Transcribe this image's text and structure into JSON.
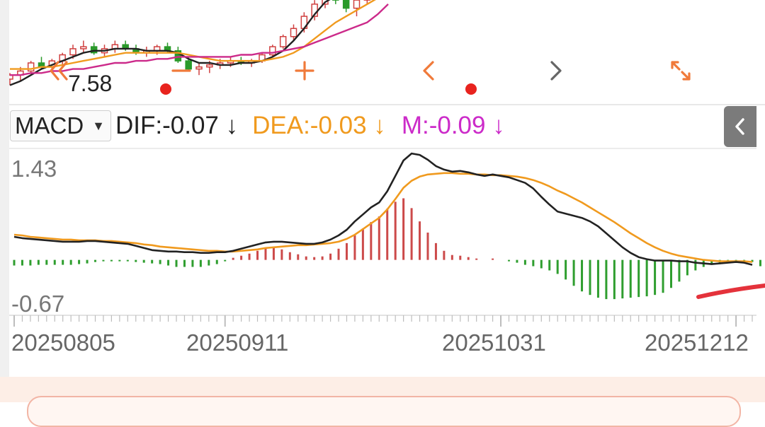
{
  "price_panel": {
    "last_price_label": "7.58",
    "controls": [
      {
        "name": "scroll-left-fast-button",
        "icon": "double-chevron-left-icon",
        "bg": "#fde6dc",
        "color": "#f07a3a"
      },
      {
        "name": "zoom-out-button",
        "icon": "minus-icon",
        "bg": "#fde6dc",
        "color": "#f07a3a"
      },
      {
        "name": "zoom-in-button",
        "icon": "plus-icon",
        "bg": "#fde6dc",
        "color": "#f07a3a"
      },
      {
        "name": "scroll-left-button",
        "icon": "chevron-left-icon",
        "bg": "#fde6dc",
        "color": "#f07a3a"
      },
      {
        "name": "scroll-right-button",
        "icon": "chevron-right-icon",
        "bg": "#eeeeee",
        "color": "#666666"
      },
      {
        "name": "fullscreen-button",
        "icon": "expand-icon",
        "bg": "#fde6dc",
        "color": "#f07a3a"
      }
    ]
  },
  "macd_header": {
    "indicator": "MACD",
    "dif": "DIF:-0.07 ↓",
    "dea": "DEA:-0.03 ↓",
    "m": "M:-0.09 ↓"
  },
  "chart_data": {
    "type": "line",
    "title": "MACD",
    "ylim": [
      -0.67,
      1.43
    ],
    "yticks": [
      "1.43",
      "-0.67"
    ],
    "x_tick_labels": [
      "20250805",
      "20250911",
      "20251031",
      "20251212"
    ],
    "x_tick_index": [
      0,
      26,
      60,
      89
    ],
    "series": [
      {
        "name": "DIF",
        "color": "#222222",
        "values": [
          0.33,
          0.31,
          0.3,
          0.29,
          0.28,
          0.27,
          0.26,
          0.26,
          0.26,
          0.27,
          0.27,
          0.26,
          0.25,
          0.24,
          0.23,
          0.2,
          0.17,
          0.14,
          0.13,
          0.12,
          0.12,
          0.11,
          0.11,
          0.1,
          0.1,
          0.11,
          0.11,
          0.13,
          0.16,
          0.19,
          0.22,
          0.25,
          0.26,
          0.26,
          0.25,
          0.24,
          0.23,
          0.23,
          0.25,
          0.29,
          0.35,
          0.43,
          0.55,
          0.65,
          0.75,
          0.82,
          0.98,
          1.2,
          1.42,
          1.52,
          1.5,
          1.43,
          1.34,
          1.29,
          1.26,
          1.27,
          1.25,
          1.22,
          1.2,
          1.22,
          1.2,
          1.18,
          1.14,
          1.1,
          1.02,
          0.9,
          0.79,
          0.69,
          0.66,
          0.63,
          0.6,
          0.55,
          0.48,
          0.38,
          0.28,
          0.18,
          0.1,
          0.04,
          0.01,
          -0.01,
          -0.01,
          -0.01,
          -0.02,
          -0.02,
          -0.04,
          -0.05,
          -0.06,
          -0.05,
          -0.04,
          -0.03,
          -0.04,
          -0.07
        ]
      },
      {
        "name": "DEA",
        "color": "#f09a1e",
        "values": [
          0.36,
          0.35,
          0.33,
          0.32,
          0.31,
          0.3,
          0.29,
          0.29,
          0.28,
          0.28,
          0.28,
          0.27,
          0.27,
          0.26,
          0.25,
          0.24,
          0.22,
          0.21,
          0.19,
          0.18,
          0.17,
          0.16,
          0.15,
          0.14,
          0.13,
          0.13,
          0.12,
          0.12,
          0.13,
          0.14,
          0.15,
          0.17,
          0.18,
          0.19,
          0.2,
          0.21,
          0.21,
          0.22,
          0.23,
          0.24,
          0.26,
          0.3,
          0.36,
          0.44,
          0.52,
          0.6,
          0.72,
          0.87,
          1.03,
          1.13,
          1.19,
          1.22,
          1.23,
          1.24,
          1.24,
          1.23,
          1.23,
          1.22,
          1.22,
          1.21,
          1.21,
          1.2,
          1.19,
          1.17,
          1.14,
          1.1,
          1.05,
          0.99,
          0.94,
          0.88,
          0.82,
          0.75,
          0.68,
          0.61,
          0.54,
          0.46,
          0.38,
          0.31,
          0.24,
          0.18,
          0.13,
          0.09,
          0.06,
          0.04,
          0.02,
          0.0,
          -0.01,
          -0.02,
          -0.02,
          -0.02,
          -0.02,
          -0.03
        ]
      },
      {
        "name": "M",
        "type": "bar",
        "up_color": "#cc4a4a",
        "down_color": "#2f9e2f",
        "values": [
          -0.08,
          -0.08,
          -0.08,
          -0.07,
          -0.07,
          -0.07,
          -0.07,
          -0.07,
          -0.06,
          -0.05,
          -0.03,
          -0.02,
          -0.02,
          -0.02,
          -0.02,
          -0.03,
          -0.04,
          -0.05,
          -0.06,
          -0.08,
          -0.1,
          -0.1,
          -0.1,
          -0.1,
          -0.08,
          -0.06,
          -0.02,
          0.03,
          0.06,
          0.09,
          0.13,
          0.16,
          0.17,
          0.15,
          0.11,
          0.08,
          0.05,
          0.04,
          0.05,
          0.09,
          0.16,
          0.24,
          0.35,
          0.45,
          0.54,
          0.62,
          0.73,
          0.83,
          0.88,
          0.74,
          0.55,
          0.39,
          0.24,
          0.13,
          0.07,
          0.06,
          0.04,
          0.02,
          0.0,
          0.02,
          0.0,
          -0.02,
          -0.04,
          -0.07,
          -0.09,
          -0.12,
          -0.15,
          -0.2,
          -0.28,
          -0.37,
          -0.45,
          -0.5,
          -0.54,
          -0.56,
          -0.56,
          -0.55,
          -0.54,
          -0.53,
          -0.52,
          -0.5,
          -0.47,
          -0.4,
          -0.31,
          -0.22,
          -0.15,
          -0.1,
          -0.07,
          -0.06,
          -0.04,
          -0.03,
          -0.03,
          -0.03,
          -0.09
        ]
      }
    ]
  },
  "price_preview": {
    "candles": [
      [
        7.47,
        7.5,
        7.44,
        7.49
      ],
      [
        7.49,
        7.53,
        7.46,
        7.51
      ],
      [
        7.51,
        7.56,
        7.5,
        7.55
      ],
      [
        7.55,
        7.58,
        7.52,
        7.53
      ],
      [
        7.53,
        7.57,
        7.51,
        7.56
      ],
      [
        7.56,
        7.6,
        7.54,
        7.59
      ],
      [
        7.59,
        7.64,
        7.57,
        7.62
      ],
      [
        7.62,
        7.66,
        7.6,
        7.63
      ],
      [
        7.63,
        7.65,
        7.59,
        7.6
      ],
      [
        7.6,
        7.64,
        7.58,
        7.62
      ],
      [
        7.62,
        7.66,
        7.6,
        7.64
      ],
      [
        7.64,
        7.66,
        7.61,
        7.62
      ],
      [
        7.62,
        7.64,
        7.59,
        7.6
      ],
      [
        7.6,
        7.63,
        7.58,
        7.61
      ],
      [
        7.61,
        7.64,
        7.59,
        7.63
      ],
      [
        7.63,
        7.65,
        7.6,
        7.61
      ],
      [
        7.61,
        7.63,
        7.55,
        7.56
      ],
      [
        7.56,
        7.58,
        7.51,
        7.52
      ],
      [
        7.52,
        7.55,
        7.49,
        7.53
      ],
      [
        7.53,
        7.56,
        7.5,
        7.54
      ],
      [
        7.54,
        7.57,
        7.52,
        7.55
      ],
      [
        7.55,
        7.58,
        7.53,
        7.56
      ],
      [
        7.56,
        7.58,
        7.54,
        7.55
      ],
      [
        7.55,
        7.57,
        7.53,
        7.56
      ],
      [
        7.56,
        7.6,
        7.55,
        7.59
      ],
      [
        7.59,
        7.64,
        7.58,
        7.63
      ],
      [
        7.63,
        7.69,
        7.62,
        7.68
      ],
      [
        7.68,
        7.74,
        7.66,
        7.72
      ],
      [
        7.72,
        7.8,
        7.7,
        7.78
      ],
      [
        7.78,
        7.86,
        7.76,
        7.84
      ],
      [
        7.84,
        7.92,
        7.82,
        7.9
      ],
      [
        7.9,
        7.96,
        7.84,
        7.86
      ],
      [
        7.86,
        7.92,
        7.8,
        7.82
      ],
      [
        7.82,
        7.88,
        7.78,
        7.86
      ],
      [
        7.86,
        7.94,
        7.84,
        7.92
      ],
      [
        7.92,
        8.0,
        7.9,
        7.98
      ],
      [
        7.98,
        8.06,
        7.96,
        8.04
      ]
    ],
    "ma_series": [
      {
        "name": "MA5",
        "color": "#222222",
        "values": [
          7.44,
          7.46,
          7.49,
          7.52,
          7.54,
          7.56,
          7.58,
          7.6,
          7.61,
          7.61,
          7.62,
          7.62,
          7.62,
          7.61,
          7.61,
          7.61,
          7.6,
          7.57,
          7.55,
          7.55,
          7.54,
          7.54,
          7.55,
          7.55,
          7.56,
          7.58,
          7.61,
          7.66,
          7.72,
          7.79,
          7.85,
          7.88,
          7.88,
          7.88,
          7.89,
          7.92,
          7.97
        ]
      },
      {
        "name": "MA10",
        "color": "#f09a1e",
        "values": [
          7.52,
          7.52,
          7.52,
          7.53,
          7.53,
          7.54,
          7.55,
          7.56,
          7.57,
          7.58,
          7.59,
          7.6,
          7.6,
          7.6,
          7.6,
          7.6,
          7.6,
          7.59,
          7.58,
          7.57,
          7.56,
          7.56,
          7.56,
          7.56,
          7.56,
          7.57,
          7.58,
          7.6,
          7.63,
          7.67,
          7.71,
          7.75,
          7.78,
          7.81,
          7.84,
          7.87,
          7.9
        ]
      },
      {
        "name": "MA20",
        "color": "#cc2a8a",
        "values": [
          7.49,
          7.49,
          7.5,
          7.5,
          7.51,
          7.51,
          7.52,
          7.52,
          7.53,
          7.54,
          7.55,
          7.55,
          7.56,
          7.56,
          7.57,
          7.57,
          7.58,
          7.58,
          7.58,
          7.58,
          7.58,
          7.58,
          7.59,
          7.59,
          7.6,
          7.6,
          7.61,
          7.62,
          7.63,
          7.65,
          7.67,
          7.69,
          7.71,
          7.73,
          7.75,
          7.79,
          7.84
        ]
      }
    ]
  }
}
